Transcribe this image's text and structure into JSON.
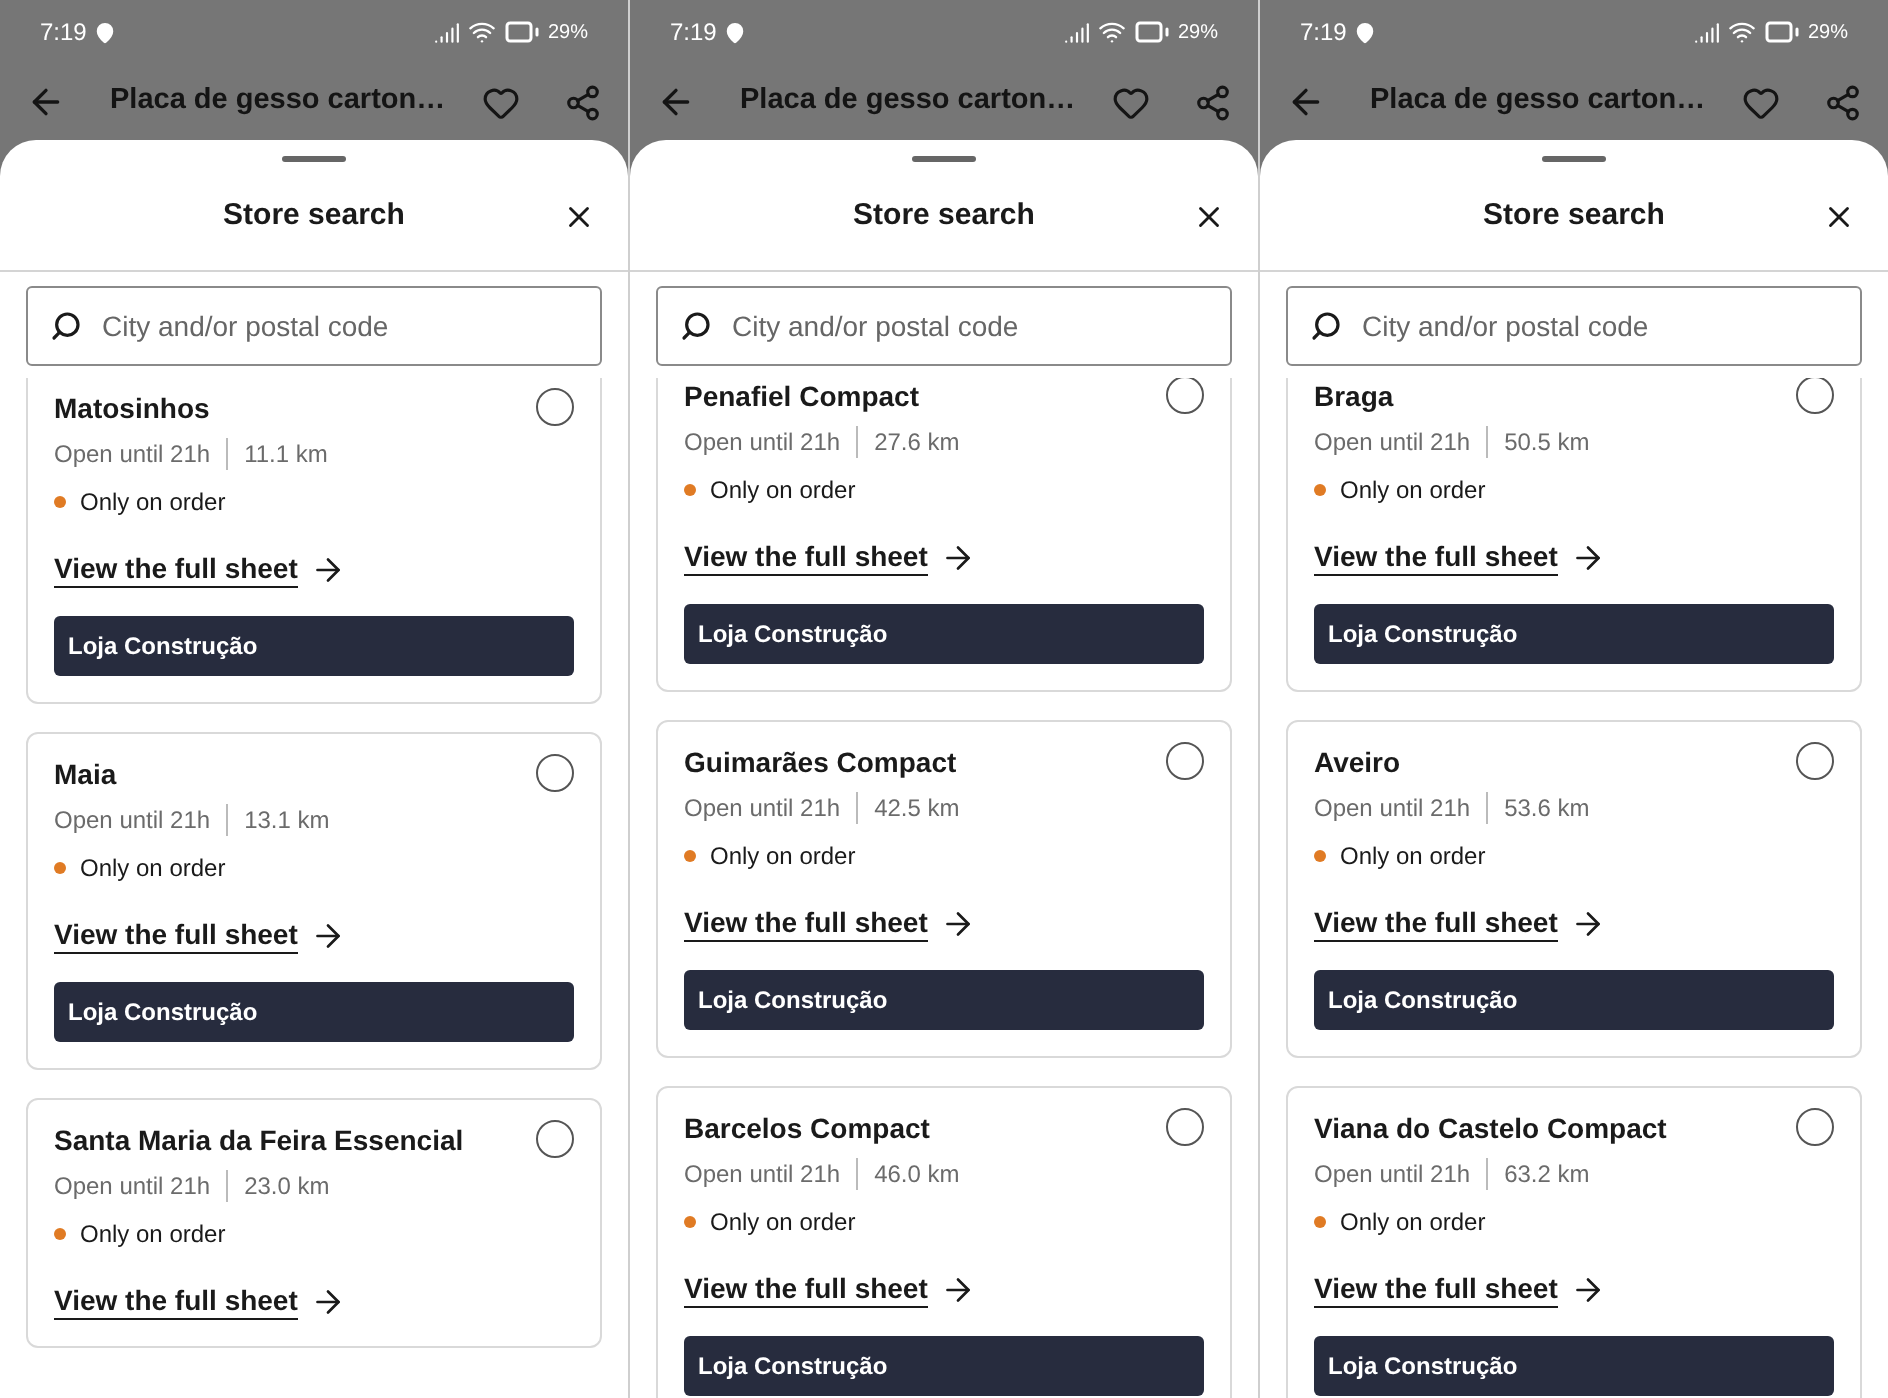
{
  "screens": [
    {
      "status_bar": {
        "time": "7:19",
        "battery": "29%"
      },
      "app_bar": {
        "title": "Placa de gesso carton…"
      },
      "sheet": {
        "title": "Store search",
        "search": {
          "placeholder": "City and/or postal code"
        },
        "stores": [
          {
            "name": "Matosinhos",
            "hours": "Open until 21h",
            "distance": "11.1 km",
            "availability": "Only on order",
            "link": "View the full sheet",
            "tag": "Loja Construção",
            "selected": false
          },
          {
            "name": "Maia",
            "hours": "Open until 21h",
            "distance": "13.1 km",
            "availability": "Only on order",
            "link": "View the full sheet",
            "tag": "Loja Construção",
            "selected": false
          },
          {
            "name": "Santa Maria da Feira Essencial",
            "hours": "Open until 21h",
            "distance": "23.0 km",
            "availability": "Only on order",
            "link": "View the full sheet",
            "selected": false
          }
        ]
      }
    },
    {
      "status_bar": {
        "time": "7:19",
        "battery": "29%"
      },
      "app_bar": {
        "title": "Placa de gesso carton…"
      },
      "sheet": {
        "title": "Store search",
        "search": {
          "placeholder": "City and/or postal code"
        },
        "stores": [
          {
            "name": "Penafiel Compact",
            "hours": "Open until 21h",
            "distance": "27.6 km",
            "availability": "Only on order",
            "link": "View the full sheet",
            "tag": "Loja Construção",
            "selected": false
          },
          {
            "name": "Guimarães Compact",
            "hours": "Open until 21h",
            "distance": "42.5 km",
            "availability": "Only on order",
            "link": "View the full sheet",
            "tag": "Loja Construção",
            "selected": false
          },
          {
            "name": "Barcelos Compact",
            "hours": "Open until 21h",
            "distance": "46.0 km",
            "availability": "Only on order",
            "link": "View the full sheet",
            "tag": "Loja Construção",
            "selected": false
          }
        ]
      }
    },
    {
      "status_bar": {
        "time": "7:19",
        "battery": "29%"
      },
      "app_bar": {
        "title": "Placa de gesso carton…"
      },
      "sheet": {
        "title": "Store search",
        "search": {
          "placeholder": "City and/or postal code"
        },
        "stores": [
          {
            "name": "Braga",
            "hours": "Open until 21h",
            "distance": "50.5 km",
            "availability": "Only on order",
            "link": "View the full sheet",
            "tag": "Loja Construção",
            "selected": false
          },
          {
            "name": "Aveiro",
            "hours": "Open until 21h",
            "distance": "53.6 km",
            "availability": "Only on order",
            "link": "View the full sheet",
            "tag": "Loja Construção",
            "selected": false
          },
          {
            "name": "Viana do Castelo Compact",
            "hours": "Open until 21h",
            "distance": "63.2 km",
            "availability": "Only on order",
            "link": "View the full sheet",
            "tag": "Loja Construção",
            "selected": false
          }
        ]
      }
    }
  ]
}
